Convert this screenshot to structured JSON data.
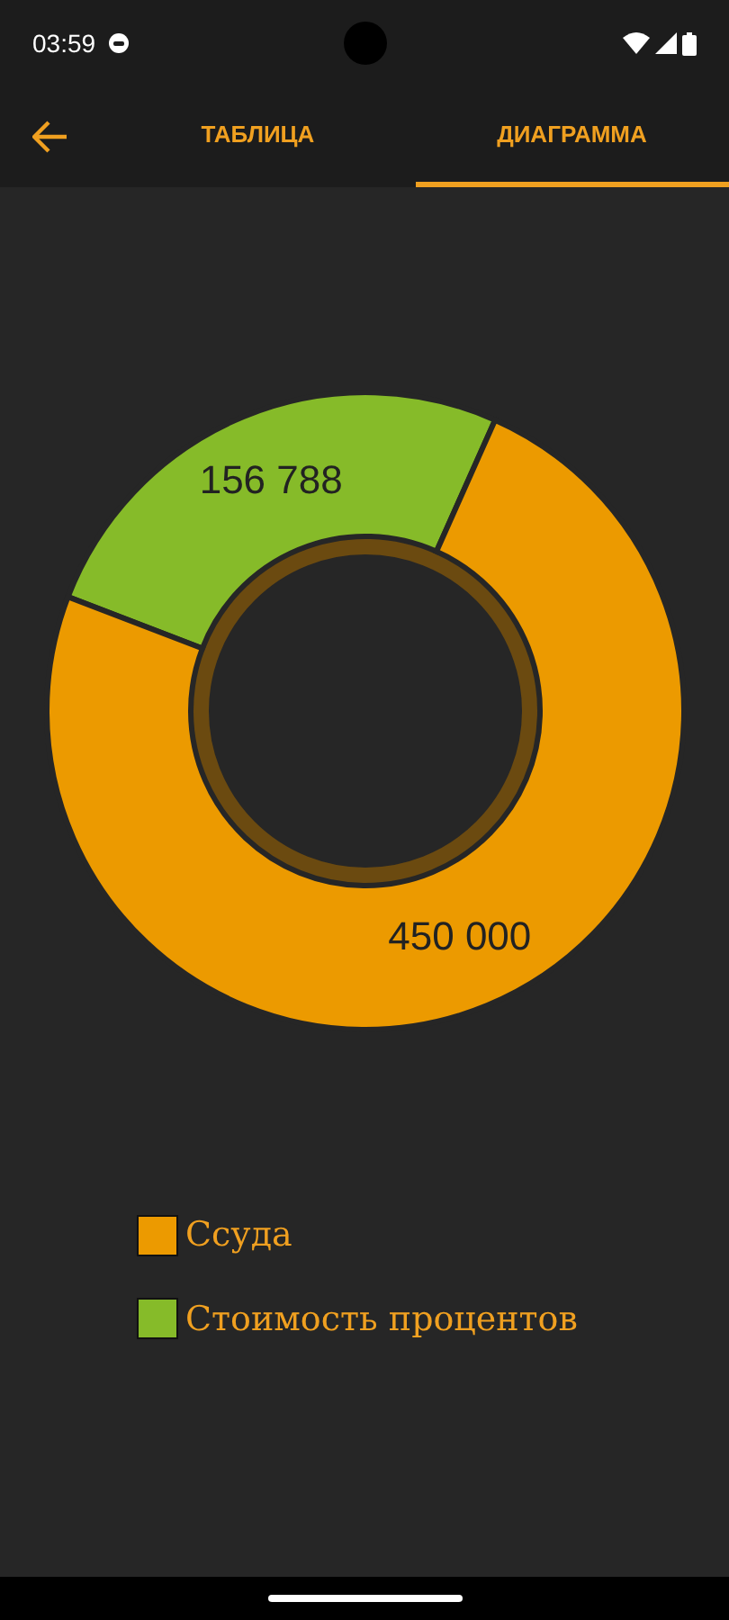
{
  "status_bar": {
    "time": "03:59"
  },
  "tabs": [
    {
      "label": "ТАБЛИЦА",
      "selected": false
    },
    {
      "label": "ДИАГРАММА",
      "selected": true
    }
  ],
  "chart_data": {
    "type": "donut",
    "categories": [
      "Ссуда",
      "Стоимость процентов"
    ],
    "values": [
      450000,
      156788
    ],
    "colors": [
      "#ec9a00",
      "#86bb29"
    ],
    "data_labels": true
  }
}
